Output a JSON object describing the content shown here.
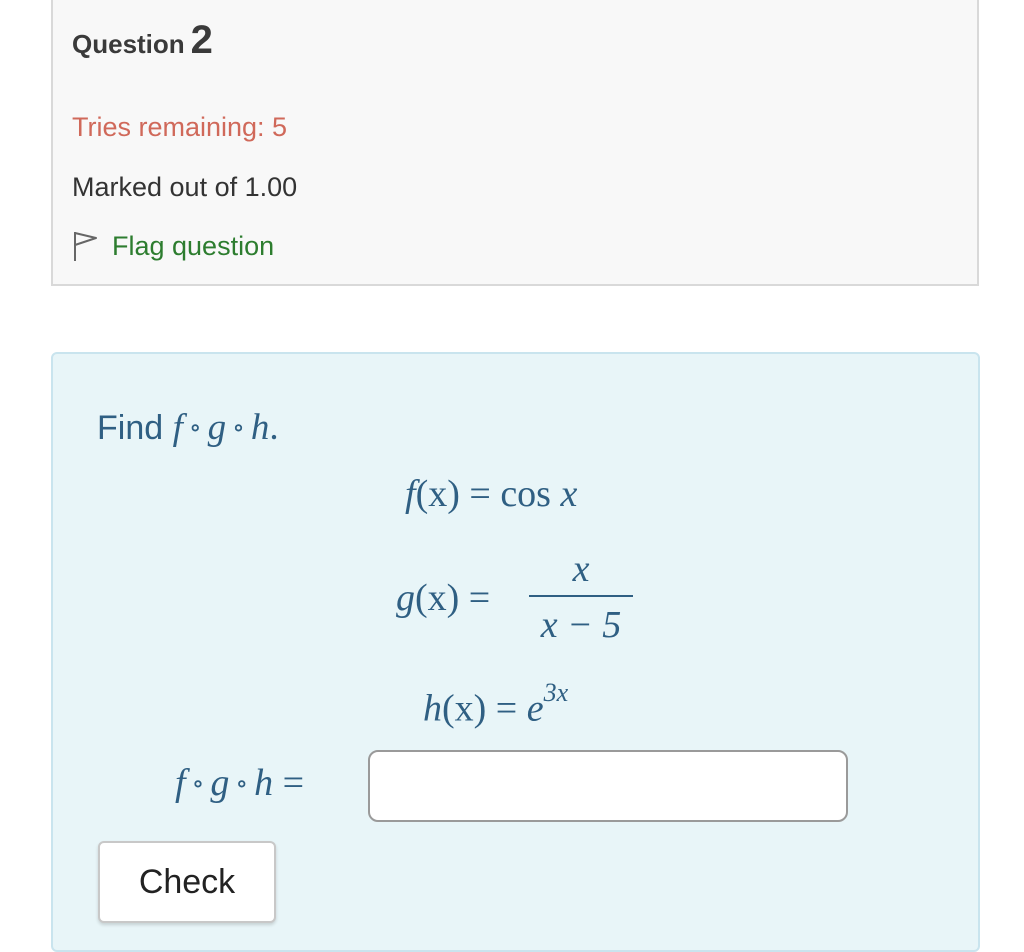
{
  "question": {
    "label": "Question",
    "number": "2",
    "tries_remaining": "Tries remaining: 5",
    "marked_out_of": "Marked out of 1.00",
    "flag": {
      "label": "Flag question",
      "icon": "flag-outline-icon"
    }
  },
  "content": {
    "prompt_label": "Find",
    "prompt_math": {
      "f": "f",
      "g": "g",
      "h": "h",
      "op": "∘",
      "end": "."
    },
    "equations": {
      "f": {
        "name": "f",
        "arg": "(x) =",
        "fn": "cos",
        "var": "x"
      },
      "g": {
        "name": "g",
        "arg": "(x) =",
        "numerator": "x",
        "denominator": "x − 5"
      },
      "h": {
        "name": "h",
        "arg": "(x) =",
        "base": "e",
        "exponent": "3x"
      }
    },
    "answer": {
      "label_f": "f",
      "label_g": "g",
      "label_h": "h",
      "op": "∘",
      "eq": "=",
      "value": "",
      "placeholder": ""
    },
    "check_button": "Check"
  },
  "colors": {
    "accent_blue": "#2f5f83",
    "tries_red": "#d0695a",
    "flag_green": "#2d7d2f",
    "content_bg": "#e8f5f8"
  }
}
